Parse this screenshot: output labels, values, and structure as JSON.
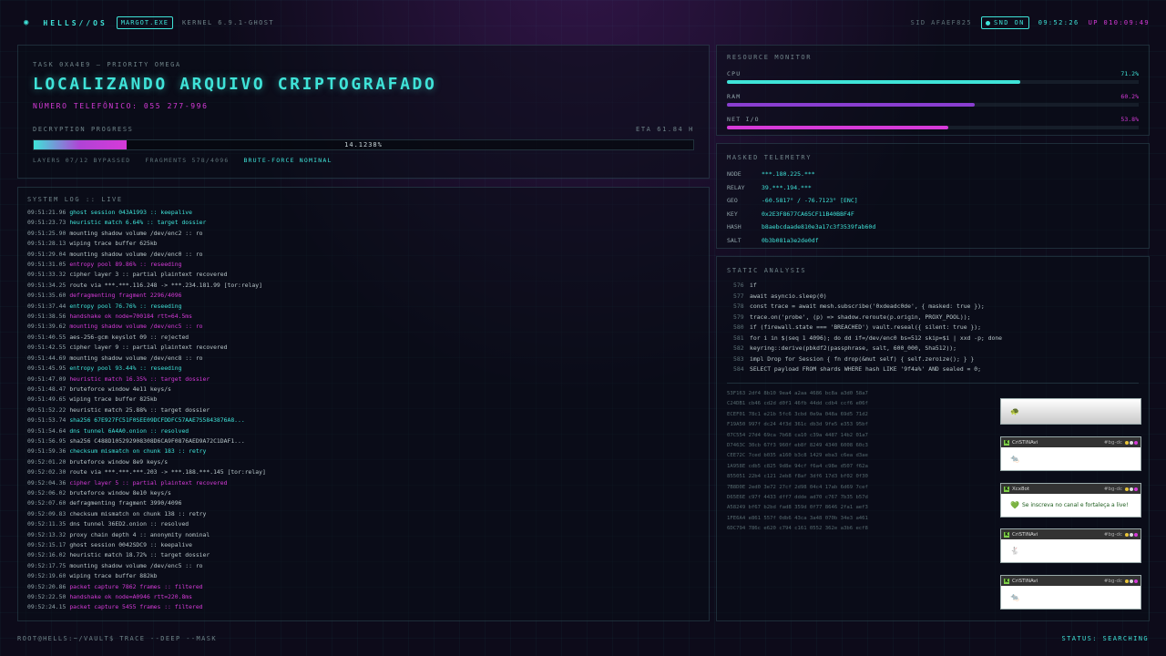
{
  "topbar": {
    "brand": "HELLS//OS",
    "app_chip": "MARGOT.EXE",
    "kernel": "KERNEL 6.9.1-GHOST",
    "sid": "SID AFAEF825",
    "snd": "SND ON",
    "clock": "09:52:26",
    "uptime": "UP 010:09:49"
  },
  "task": {
    "subtitle": "TASK 0XA4E9 — PRIORITY OMEGA",
    "title": "LOCALIZANDO ARQUIVO CRIPTOGRAFADO",
    "phone": "NÚMERO TELEFÔNICO: 055 277-996",
    "progress_label": "DECRYPTION PROGRESS",
    "eta": "ETA 61.84 H",
    "progress_text": "14.1238%",
    "progress_value": 0.141,
    "layers": "LAYERS 07/12 BYPASSED",
    "fragments": "FRAGMENTS 578/4096",
    "bruteforce": "BRUTE-FORCE NOMINAL"
  },
  "log": {
    "title": "SYSTEM LOG :: LIVE",
    "lines": [
      {
        "t": "09:51:21.96",
        "msg": "ghost session 043A1993 :: keepalive",
        "c": "c"
      },
      {
        "t": "09:51:23.73",
        "msg": "heuristic match 6.64% :: target dossier",
        "c": "c"
      },
      {
        "t": "09:51:25.90",
        "msg": "mounting shadow volume /dev/enc2 :: ro",
        "c": ""
      },
      {
        "t": "09:51:28.13",
        "msg": "wiping trace buffer 625kb",
        "c": ""
      },
      {
        "t": "09:51:29.04",
        "msg": "mounting shadow volume /dev/enc0 :: ro",
        "c": ""
      },
      {
        "t": "09:51:31.05",
        "msg": "entropy pool 89.86% :: reseeding",
        "c": "m"
      },
      {
        "t": "09:51:33.32",
        "msg": "cipher layer 3 :: partial plaintext recovered",
        "c": ""
      },
      {
        "t": "09:51:34.25",
        "msg": "route via ***.***.116.248 -> ***.234.181.99 [tor:relay]",
        "c": ""
      },
      {
        "t": "09:51:35.60",
        "msg": "defragmenting fragment 2296/4096",
        "c": "m"
      },
      {
        "t": "09:51:37.44",
        "msg": "entropy pool 76.76% :: reseeding",
        "c": "c"
      },
      {
        "t": "09:51:38.56",
        "msg": "handshake ok node=700184 rtt=64.5ms",
        "c": "m"
      },
      {
        "t": "09:51:39.62",
        "msg": "mounting shadow volume /dev/enc5 :: ro",
        "c": "m"
      },
      {
        "t": "09:51:40.55",
        "msg": "aes-256-gcm keyslot 09 :: rejected",
        "c": ""
      },
      {
        "t": "09:51:42.55",
        "msg": "cipher layer 9 :: partial plaintext recovered",
        "c": ""
      },
      {
        "t": "09:51:44.69",
        "msg": "mounting shadow volume /dev/enc8 :: ro",
        "c": ""
      },
      {
        "t": "09:51:45.95",
        "msg": "entropy pool 93.44% :: reseeding",
        "c": "c"
      },
      {
        "t": "09:51:47.09",
        "msg": "heuristic match 16.35% :: target dossier",
        "c": "m"
      },
      {
        "t": "09:51:48.47",
        "msg": "bruteforce window 4e11 keys/s",
        "c": ""
      },
      {
        "t": "09:51:49.65",
        "msg": "wiping trace buffer 825kb",
        "c": ""
      },
      {
        "t": "09:51:52.22",
        "msg": "heuristic match 25.88% :: target dossier",
        "c": ""
      },
      {
        "t": "09:51:53.74",
        "msg": "sha256 67E927FC51F0SEE09DCFDDFC57AAE7S5843876A8...",
        "c": "c"
      },
      {
        "t": "09:51:54.64",
        "msg": "dns tunnel 6A4A0.onion :: resolved",
        "c": "c"
      },
      {
        "t": "09:51:56.95",
        "msg": "sha256 C488D105292908308D6CA9F0876AED9A72C1DAF1...",
        "c": ""
      },
      {
        "t": "09:51:59.36",
        "msg": "checksum mismatch on chunk 183 :: retry",
        "c": "c"
      },
      {
        "t": "09:52:01.20",
        "msg": "bruteforce window 8e9 keys/s",
        "c": ""
      },
      {
        "t": "09:52:02.30",
        "msg": "route via ***.***.***.203 -> ***.188.***.145 [tor:relay]",
        "c": ""
      },
      {
        "t": "09:52:04.36",
        "msg": "cipher layer 5 :: partial plaintext recovered",
        "c": "m"
      },
      {
        "t": "09:52:06.02",
        "msg": "bruteforce window 8e10 keys/s",
        "c": ""
      },
      {
        "t": "09:52:07.60",
        "msg": "defragmenting fragment 3990/4096",
        "c": ""
      },
      {
        "t": "09:52:09.83",
        "msg": "checksum mismatch on chunk 138 :: retry",
        "c": ""
      },
      {
        "t": "09:52:11.35",
        "msg": "dns tunnel 36ED2.onion :: resolved",
        "c": ""
      },
      {
        "t": "09:52:13.32",
        "msg": "proxy chain depth 4 :: anonymity nominal",
        "c": ""
      },
      {
        "t": "09:52:15.17",
        "msg": "ghost session 0042SDC9 :: keepalive",
        "c": ""
      },
      {
        "t": "09:52:16.02",
        "msg": "heuristic match 18.72% :: target dossier",
        "c": ""
      },
      {
        "t": "09:52:17.75",
        "msg": "mounting shadow volume /dev/enc5 :: ro",
        "c": ""
      },
      {
        "t": "09:52:19.60",
        "msg": "wiping trace buffer 882kb",
        "c": ""
      },
      {
        "t": "09:52:20.86",
        "msg": "packet capture 7862 frames :: filtered",
        "c": "m"
      },
      {
        "t": "09:52:22.50",
        "msg": "handshake ok node=A0946 rtt=220.8ms",
        "c": "m"
      },
      {
        "t": "09:52:24.15",
        "msg": "packet capture 5455 frames :: filtered",
        "c": "m"
      }
    ]
  },
  "resources": {
    "title": "RESOURCE MONITOR",
    "meters": [
      {
        "label": "CPU",
        "value": "71.2%",
        "fraction": 0.712,
        "color": "#3fe3d8"
      },
      {
        "label": "RAM",
        "value": "60.2%",
        "fraction": 0.602,
        "color": "#8a3ed0"
      },
      {
        "label": "NET I/O",
        "value": "53.8%",
        "fraction": 0.538,
        "color": "#d63ad8"
      }
    ]
  },
  "telemetry": {
    "title": "MASKED TELEMETRY",
    "rows": [
      {
        "k": "NODE",
        "v": "***.180.225.***"
      },
      {
        "k": "RELAY",
        "v": "39.***.194.***"
      },
      {
        "k": "GEO",
        "v": "-60.5817° / -76.7123° [ENC]"
      },
      {
        "k": "KEY",
        "v": "0x2E3F8677CA65CF11B40BBF4F"
      },
      {
        "k": "HASH",
        "v": "b8aebcdaade810e3a17c3f3539fab60d"
      },
      {
        "k": "SALT",
        "v": "0b3b081a3e2de0df"
      }
    ]
  },
  "static": {
    "title": "STATIC ANALYSIS",
    "code": [
      {
        "n": "576",
        "s": "if"
      },
      {
        "n": "577",
        "s": "await asyncio.sleep(0)"
      },
      {
        "n": "578",
        "s": "const trace = await mesh.subscribe('0xdeadc0de', { masked: true });"
      },
      {
        "n": "579",
        "s": "trace.on('probe', (p) => shadow.reroute(p.origin, PROXY_POOL));"
      },
      {
        "n": "580",
        "s": "if (firewall.state === 'BREACHED') vault.reseal({ silent: true });"
      },
      {
        "n": "581",
        "s": "for i in $(seq 1 4096); do dd if=/dev/enc0 bs=512 skip=$i | xxd -p; done"
      },
      {
        "n": "582",
        "s": "keyring::derive(pbkdf2(passphrase, salt, 600_000, Sha512));"
      },
      {
        "n": "583",
        "s": "impl Drop for Session { fn drop(&mut self) { self.zeroize(); } }"
      },
      {
        "n": "584",
        "s": "SELECT payload FROM shards WHERE hash LIKE '9f4a%' AND sealed = 0;"
      }
    ],
    "hex": [
      "53F163 2df4 8b10 9ea4 a2aa 4686 bc8a a3d0 58a7",
      "C24DB1 cb46 cd2d d0f1 46fb 44dd cdb4 ccf6 e06f",
      "ECEF01 78c1 e21b 5fc6 3cbd 0e9a 048a 69d5 71d2",
      "F19A50 997f dc24 4f3d 361c db3d 9fe5 e353 95bf",
      "07C554 27d4 69ca 7b68 ca10 c39a 4487 14b2 01a7",
      "D7463C 30cb 67f3 960f eb8f 8249 4340 6008 60c3",
      "CEE72C 7ced b035 a160 b3c8 1429 eba3 c6ea d3ae",
      "1A958E cdb5 c825 9d8e 94cf f6a4 c98e d507 f62a",
      "855051 22b4 c121 2eb8 f8af 3df6 17d3 bf02 0f30",
      "7B8D0E 2ed0 3e72 27cf 2d98 04c4 17ab 6d69 7cef",
      "D65E6E c97f 4433 dff7 ddde ad70 c767 7b35 b57d",
      "A58249 bf67 b2bd fad8 359d 0f77 8646 2fa1 aef3",
      "1FE6A4 e861 557f 0db6 43ca 3a48 070b 34e3 a461",
      "6DC794 786c e620 c794 c161 0552 362e a3b6 ecf8"
    ]
  },
  "chats": [
    {
      "name": "",
      "tag": "",
      "body": "",
      "emoji": "🐢",
      "variant": "gray"
    },
    {
      "name": "CriSTiNAvi",
      "tag": "#bg-dc",
      "body": "",
      "emoji": "🐀",
      "variant": "plain"
    },
    {
      "name": "Xcx8ot",
      "tag": "#bg-dc",
      "body": "Se inscreva no canal e fortaleça a live!",
      "emoji": "💚",
      "variant": "plain"
    },
    {
      "name": "CriSTiNAvi",
      "tag": "#bg-dc",
      "body": "",
      "emoji": "🐇",
      "variant": "plain"
    },
    {
      "name": "CriSTiNAvi",
      "tag": "#bg-dc",
      "body": "",
      "emoji": "🐀",
      "variant": "plain"
    }
  ],
  "bottom": {
    "prompt": "ROOT@HELLS:~/VAULT$ TRACE --DEEP --MASK",
    "status": "STATUS: SEARCHING"
  }
}
